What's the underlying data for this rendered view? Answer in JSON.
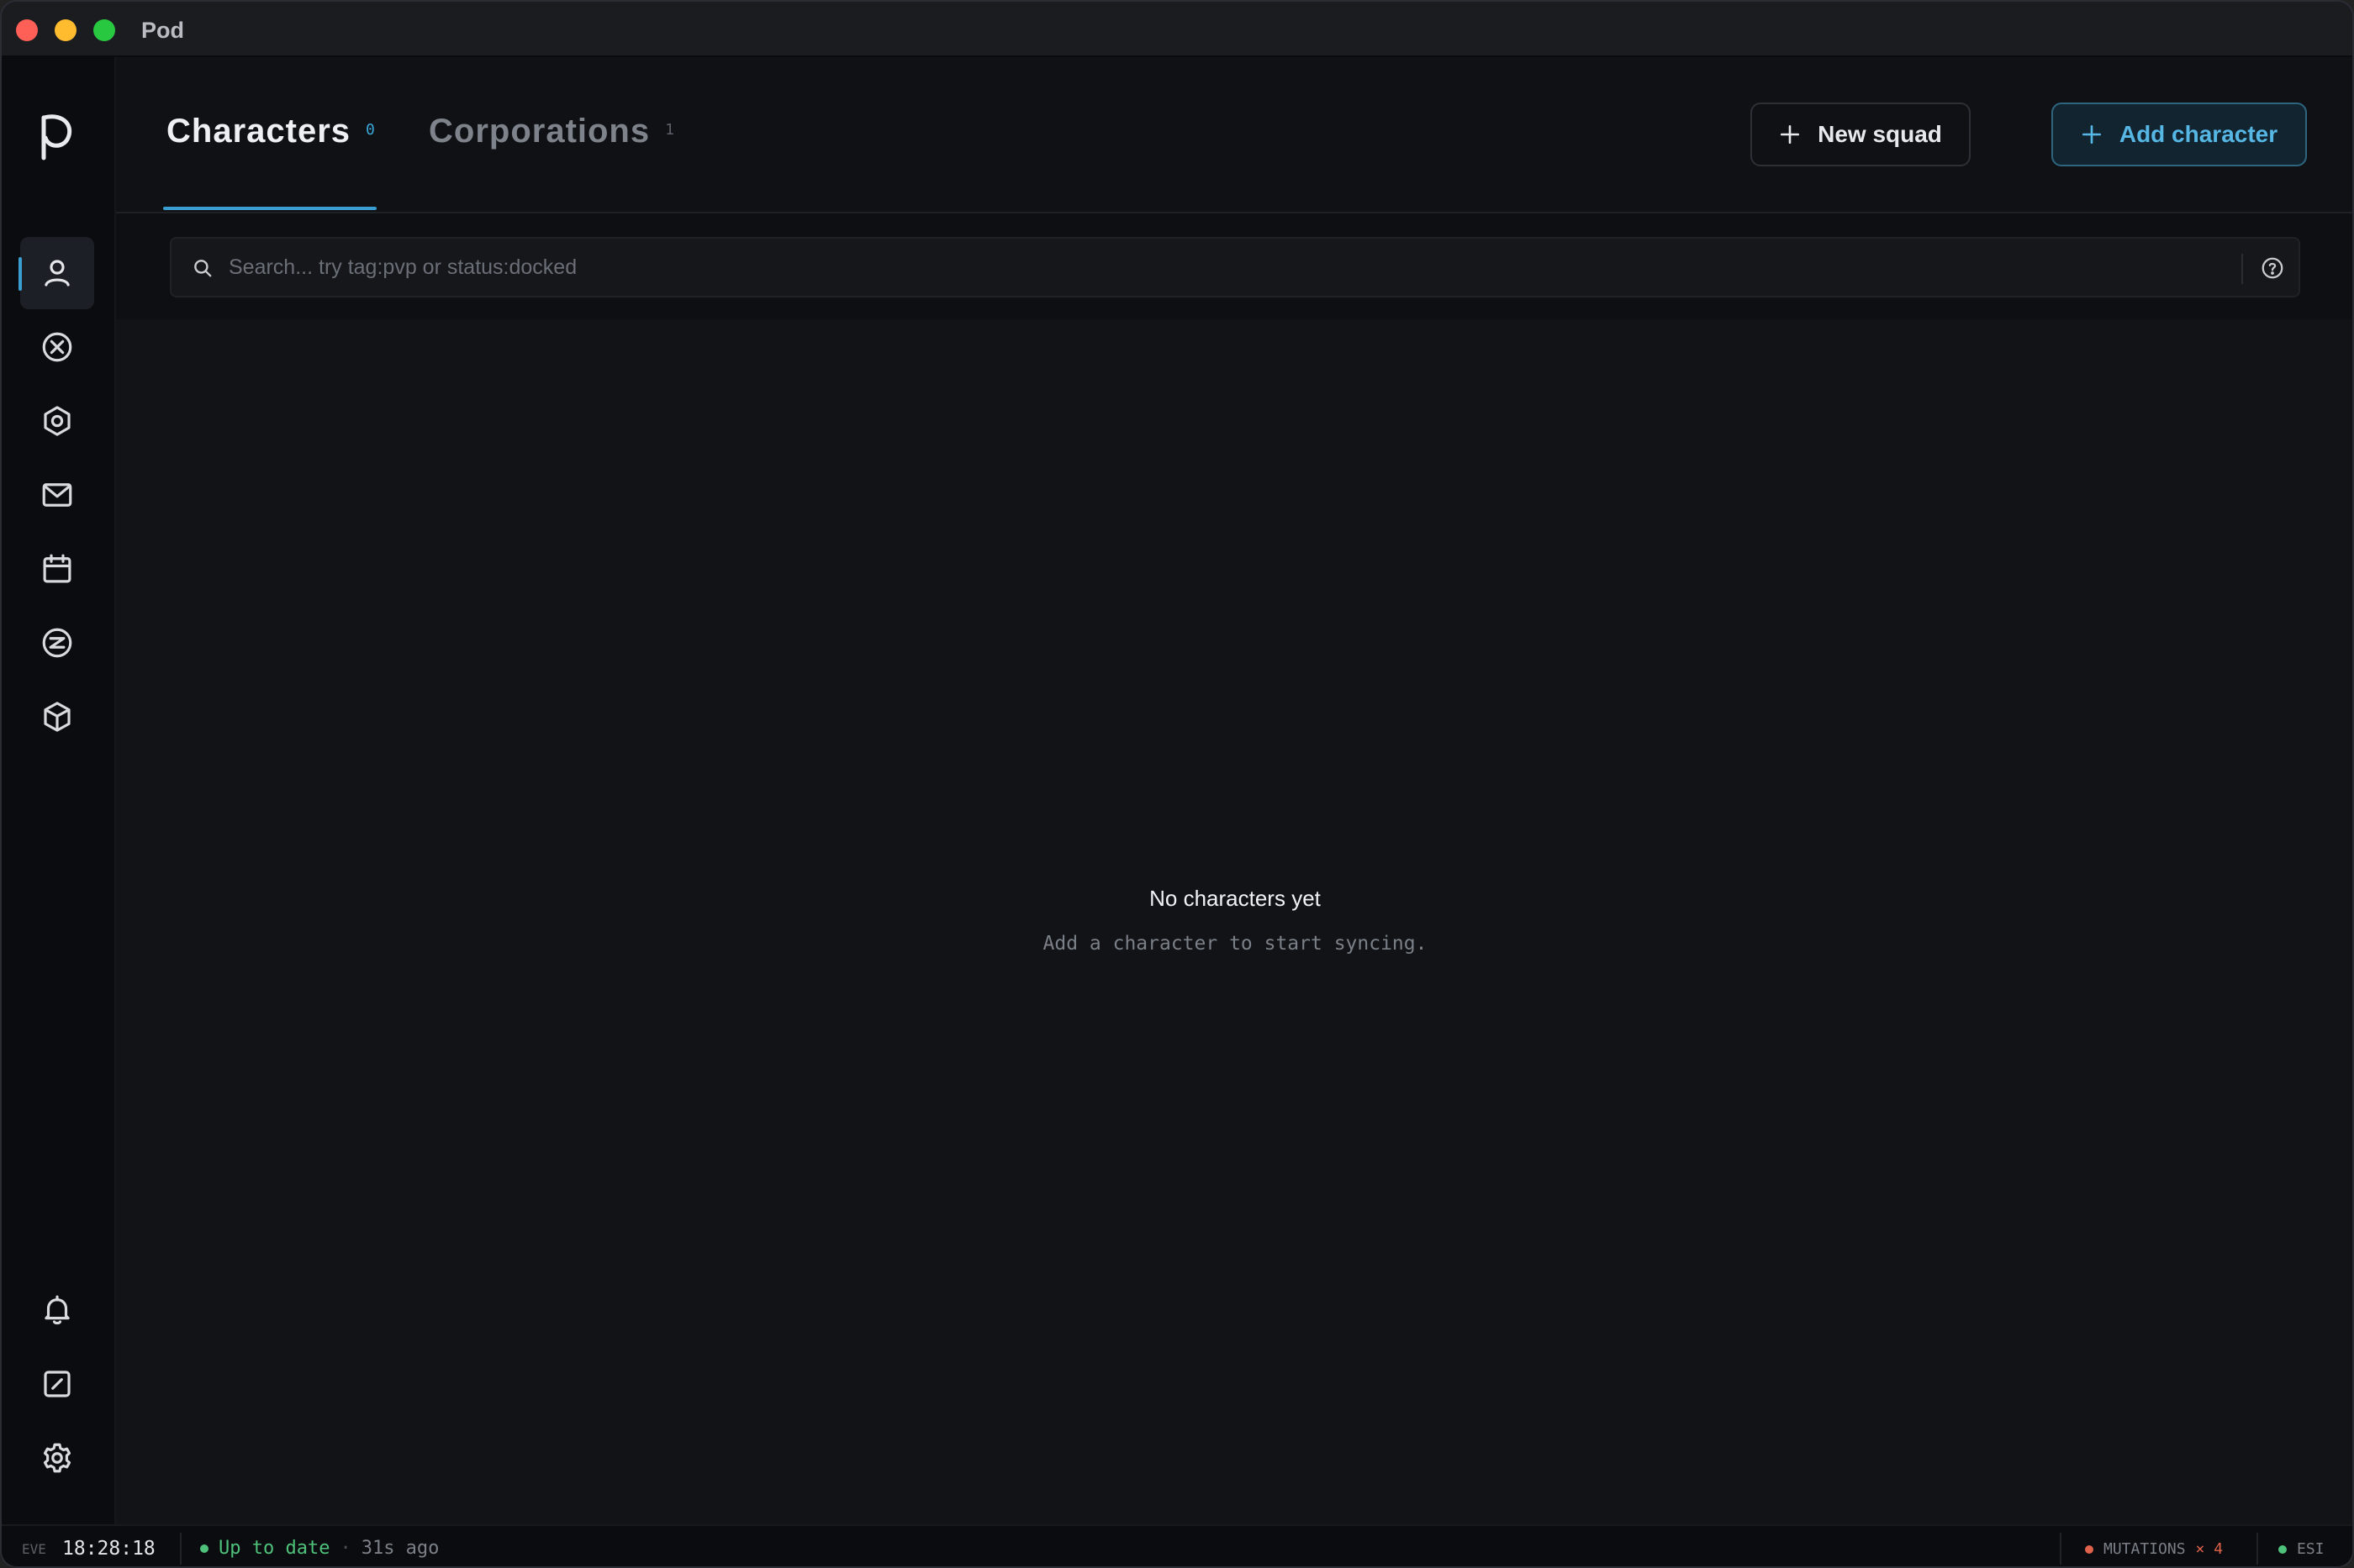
{
  "window": {
    "title": "Pod"
  },
  "sidebar": {
    "items": [
      {
        "icon": "user-icon",
        "active": true
      },
      {
        "icon": "circle-x-icon",
        "active": false
      },
      {
        "icon": "hexagon-nut-icon",
        "active": false
      },
      {
        "icon": "mail-icon",
        "active": false
      },
      {
        "icon": "calendar-icon",
        "active": false
      },
      {
        "icon": "circle-z-icon",
        "active": false
      },
      {
        "icon": "cube-icon",
        "active": false
      }
    ],
    "bottom_items": [
      {
        "icon": "bell-icon"
      },
      {
        "icon": "gauge-icon"
      },
      {
        "icon": "gear-icon"
      }
    ]
  },
  "header": {
    "tabs": [
      {
        "label": "Characters",
        "count": "0",
        "active": true
      },
      {
        "label": "Corporations",
        "count": "1",
        "active": false
      }
    ],
    "new_squad_label": "New squad",
    "add_character_label": "Add character"
  },
  "search": {
    "placeholder": "Search... try tag:pvp or status:docked",
    "value": ""
  },
  "main": {
    "empty_title": "No characters yet",
    "empty_subtitle": "Add a character to start syncing."
  },
  "statusbar": {
    "eve_label": "EVE",
    "time": "18:28:18",
    "sync_status": "Up to date",
    "sync_sep": "·",
    "sync_ago": "31s ago",
    "mutations_label": "MUTATIONS",
    "mutations_count": "× 4",
    "esi_label": "ESI"
  },
  "colors": {
    "accent": "#3a9fd0",
    "ok": "#4ec17a",
    "error": "#e0624a"
  }
}
